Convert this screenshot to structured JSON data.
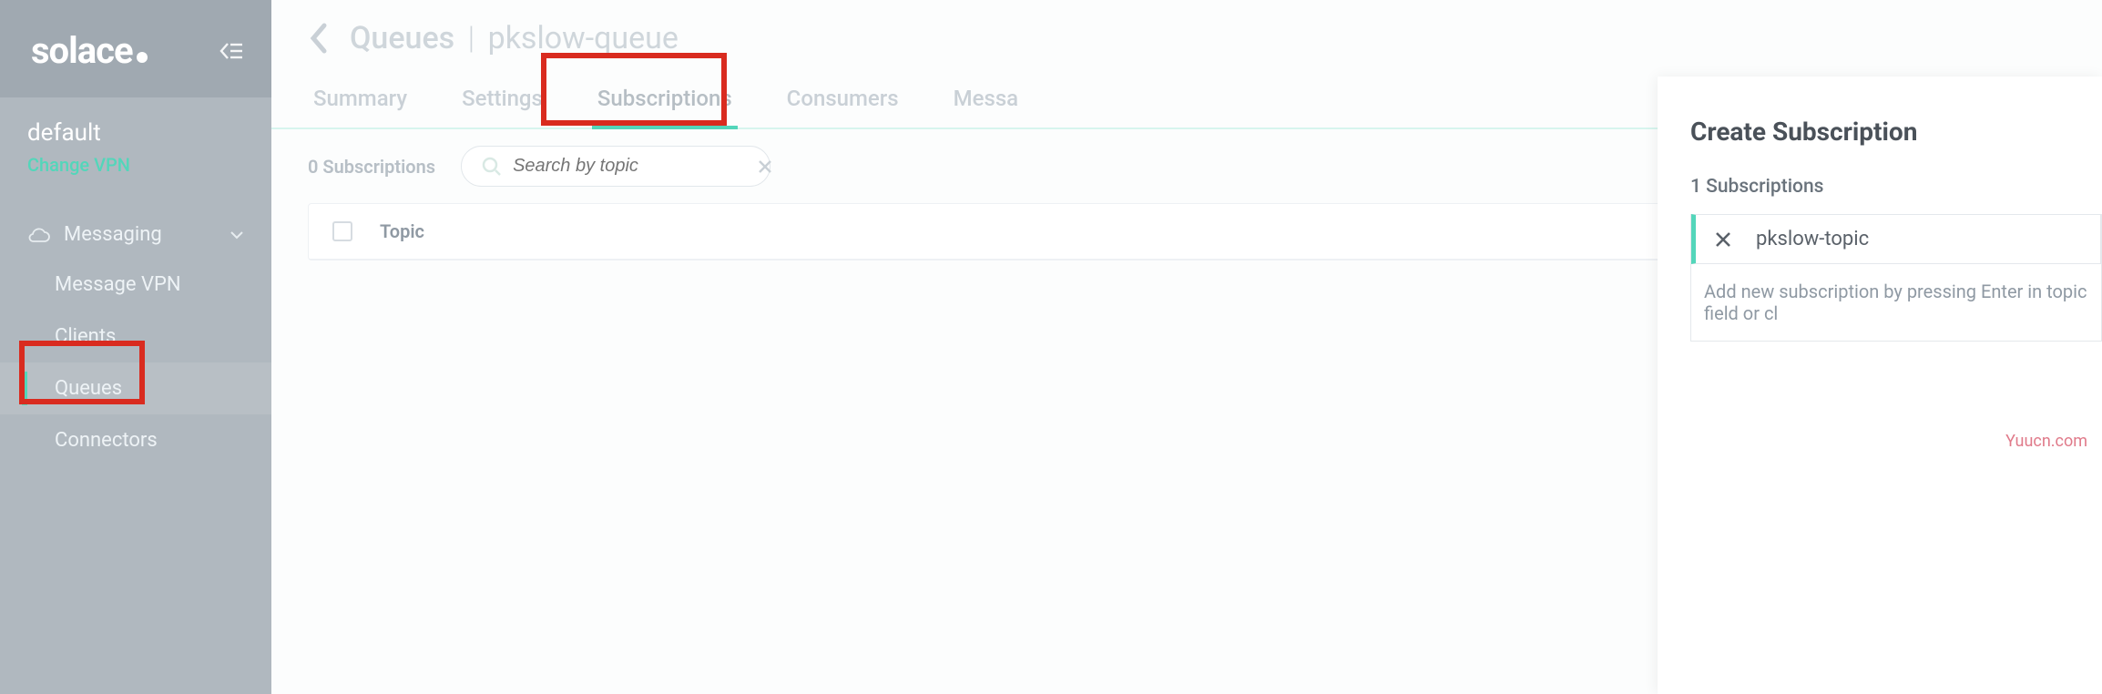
{
  "brand": "solace",
  "vpn": {
    "name": "default",
    "change_label": "Change VPN"
  },
  "nav": {
    "section_label": "Messaging",
    "items": [
      {
        "label": "Message VPN"
      },
      {
        "label": "Clients"
      },
      {
        "label": "Queues"
      },
      {
        "label": "Connectors"
      }
    ]
  },
  "breadcrumb": {
    "parent": "Queues",
    "current": "pkslow-queue"
  },
  "tabs": [
    "Summary",
    "Settings",
    "Subscriptions",
    "Consumers",
    "Messa"
  ],
  "active_tab_index": 2,
  "filter": {
    "count_text": "0 Subscriptions",
    "search_placeholder": "Search by topic"
  },
  "table": {
    "header": "Topic"
  },
  "panel": {
    "title": "Create Subscription",
    "sub_count_text": "1 Subscriptions",
    "chips": [
      {
        "label": "pkslow-topic"
      }
    ],
    "hint": "Add new subscription by pressing Enter in topic field or cl"
  },
  "watermark": "Yuucn.com"
}
